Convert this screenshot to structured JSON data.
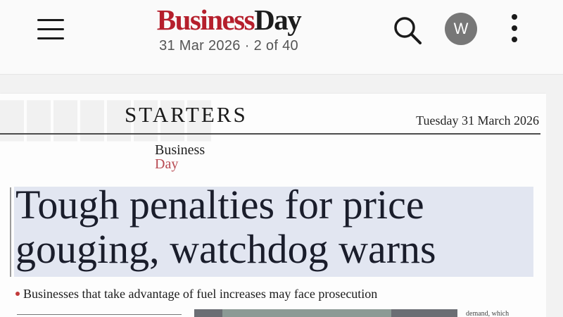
{
  "header": {
    "brand_part1": "Business",
    "brand_part2": "Day",
    "date": "31 Mar 2026",
    "separator": "·",
    "page_counter": "2 of 40",
    "avatar_initial": "W",
    "icons": [
      "menu-icon",
      "search-icon",
      "more-vertical-icon"
    ]
  },
  "page": {
    "section": "STARTERS",
    "edition_date": "Tuesday 31 March 2026",
    "logo_line1": "Business",
    "logo_line2": "Day",
    "headline_line1": "Tough penalties for price",
    "headline_line2": "gouging, watchdog warns",
    "standfirst": "Businesses that take advantage of fuel increases may face prosecution",
    "column_snippet": "demand, which"
  },
  "colors": {
    "brand_red": "#b51f2c",
    "highlight": "#e2e6f1",
    "avatar_bg": "#777777"
  }
}
